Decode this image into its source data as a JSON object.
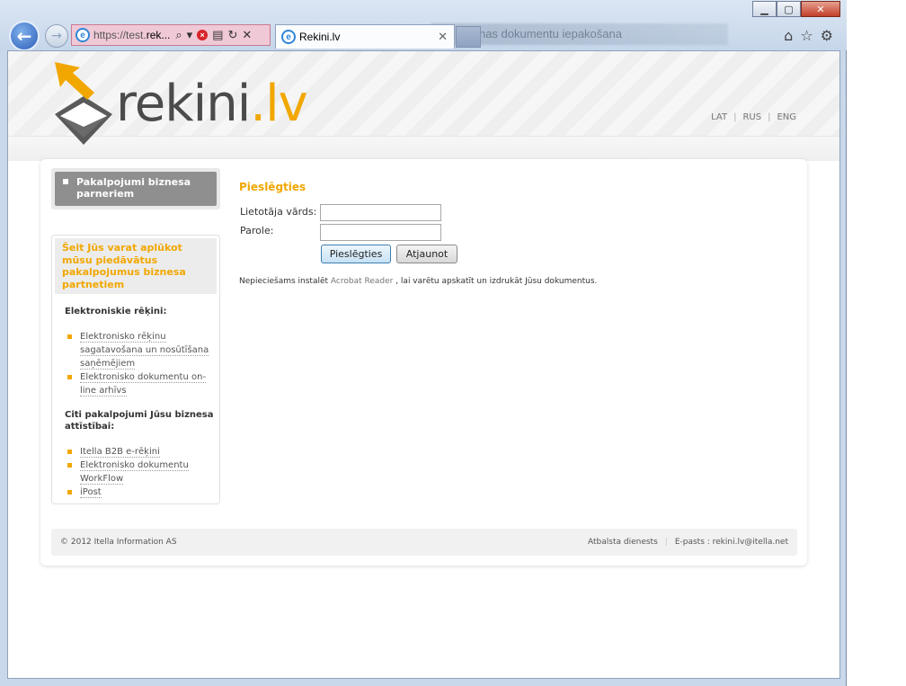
{
  "browser": {
    "address_url_prefix": "https://test.",
    "address_url_bold": "rek...",
    "tab_title": "Rekini.lv",
    "background_window_title": "Jaunas dokumentu iepakošana"
  },
  "site": {
    "logo_main": "rekini",
    "logo_dot": ".lv",
    "languages": [
      "LAT",
      "RUS",
      "ENG"
    ],
    "accent_color": "#f1a700"
  },
  "sidebar": {
    "top_button": "Pakalpojumi biznesa parneriem",
    "promo": "Šeit Jūs varat aplūkot mūsu piedāvātus pakalpojumus biznesa partnetiem",
    "section1_heading": "Elektroniskie rēķini:",
    "section1_items": [
      "Elektronisko rēķinu sagatavošana un nosūtīšana saņēmējiem",
      "Elektronisko dokumentu on-line arhīvs"
    ],
    "section2_heading": "Citi pakalpojumi Jūsu biznesa attīstībai:",
    "section2_items": [
      "Itella B2B e-rēķini",
      "Elektronisko dokumentu WorkFlow",
      "iPost"
    ]
  },
  "login": {
    "title": "Pieslēgties",
    "username_label": "Lietotāja vārds:",
    "password_label": "Parole:",
    "submit_label": "Pieslēgties",
    "reset_label": "Atjaunot",
    "notice_before": "Nepieciešams instalēt ",
    "notice_link": "Acrobat Reader",
    "notice_after": " , lai varētu apskatīt un izdrukāt Jūsu dokumentus."
  },
  "footer": {
    "copyright": "© 2012 Itella Information AS",
    "support": "Atbalsta dienests",
    "email": "E-pasts : rekini.lv@itella.net"
  }
}
